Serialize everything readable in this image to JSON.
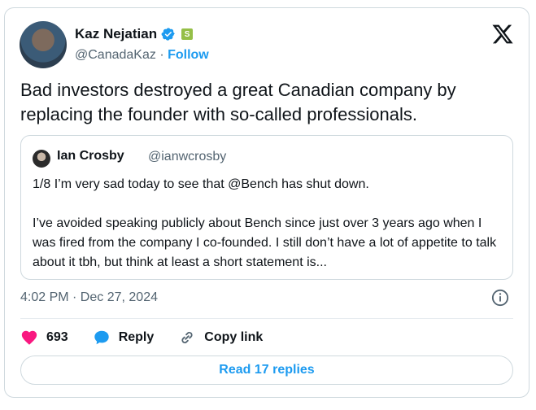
{
  "author": {
    "name": "Kaz Nejatian",
    "handle": "@CanadaKaz",
    "follow_label": "Follow"
  },
  "tweet": {
    "text": "Bad investors destroyed a great Canadian company by replacing the founder with so-called professionals.",
    "timestamp": "4:02 PM · Dec 27, 2024"
  },
  "quote": {
    "name": "Ian Crosby",
    "handle": "@ianwcrosby",
    "text": "1/8 I’m very sad today to see that @Bench has shut down.\n\nI’ve avoided speaking publicly about Bench since just over 3 years ago when I was fired from the company I co-founded. I still don’t have a lot of appetite to talk about it tbh, but think at least a short statement is..."
  },
  "actions": {
    "likes": "693",
    "reply_label": "Reply",
    "copy_label": "Copy link",
    "read_replies": "Read 17 replies"
  },
  "colors": {
    "accent": "#1d9bf0",
    "like": "#f91880",
    "secondary_text": "#536471",
    "border": "#cfd9de"
  },
  "icons": [
    "verified-badge-icon",
    "shopify-badge-icon",
    "x-logo-icon",
    "info-icon",
    "heart-icon",
    "reply-bubble-icon",
    "link-icon"
  ]
}
